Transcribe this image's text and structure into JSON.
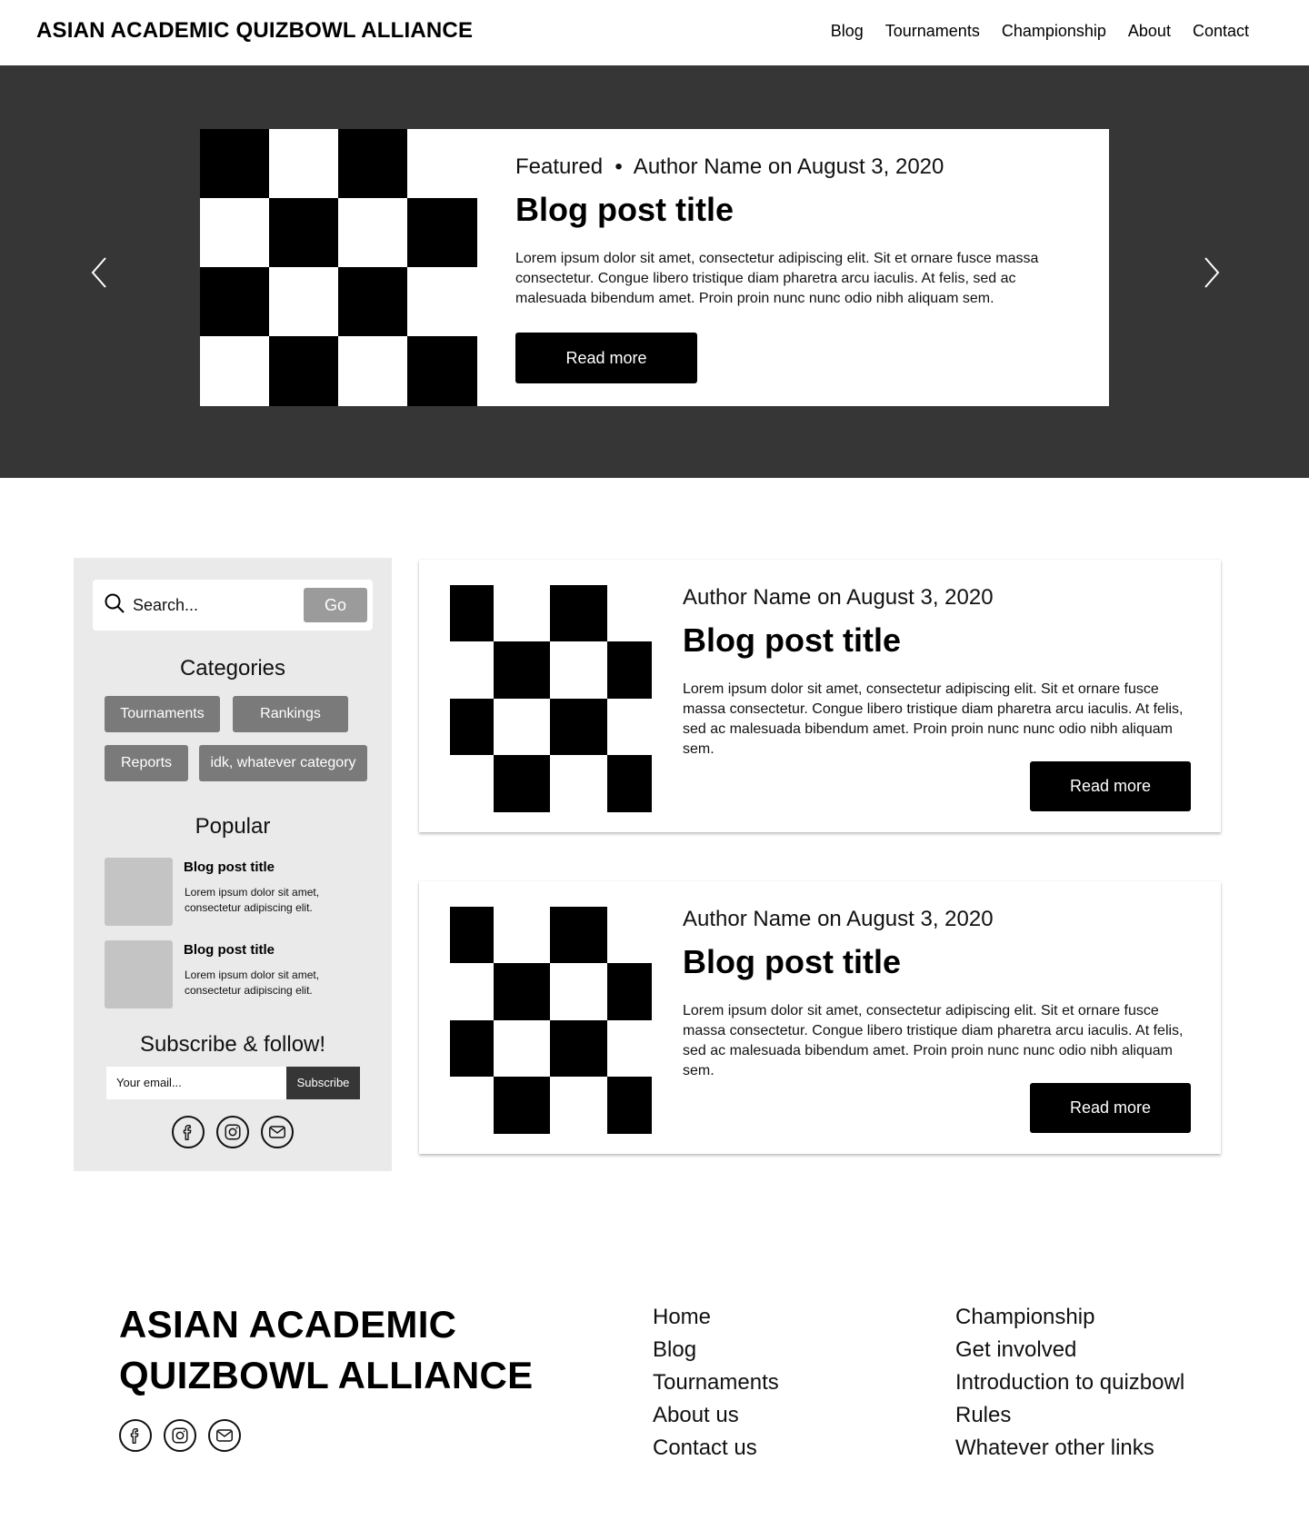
{
  "header": {
    "logo": "ASIAN ACADEMIC QUIZBOWL ALLIANCE",
    "nav": [
      "Blog",
      "Tournaments",
      "Championship",
      "About",
      "Contact"
    ]
  },
  "hero": {
    "meta": "Featured  •  Author Name on August 3, 2020",
    "title": "Blog post title",
    "excerpt": "Lorem ipsum dolor sit amet, consectetur adipiscing elit. Sit et ornare fusce massa consectetur. Congue libero tristique diam pharetra arcu iaculis. At felis, sed ac malesuada bibendum amet. Proin proin nunc nunc odio nibh aliquam sem.",
    "button": "Read more",
    "prev_icon": "chevron-left-icon",
    "next_icon": "chevron-right-icon"
  },
  "sidebar": {
    "search_placeholder": "Search...",
    "go": "Go",
    "categories_title": "Categories",
    "categories": [
      "Tournaments",
      "Rankings",
      "Reports",
      "idk, whatever category"
    ],
    "popular_title": "Popular",
    "popular": [
      {
        "title": "Blog post title",
        "text": "Lorem ipsum dolor sit amet, consectetur adipiscing elit."
      },
      {
        "title": "Blog post title",
        "text": "Lorem ipsum dolor sit amet, consectetur adipiscing elit."
      }
    ],
    "subscribe_title": "Subscribe & follow!",
    "email_placeholder": "Your email...",
    "subscribe_button": "Subscribe",
    "social_icons": [
      "facebook-icon",
      "instagram-icon",
      "mail-icon"
    ]
  },
  "posts": [
    {
      "meta": "Author Name on August 3, 2020",
      "title": "Blog post title",
      "excerpt": "Lorem ipsum dolor sit amet, consectetur adipiscing elit. Sit et ornare fusce massa consectetur. Congue libero tristique diam pharetra arcu iaculis. At felis, sed ac malesuada bibendum amet. Proin proin nunc nunc odio nibh aliquam sem.",
      "button": "Read more"
    },
    {
      "meta": "Author Name on August 3, 2020",
      "title": "Blog post title",
      "excerpt": "Lorem ipsum dolor sit amet, consectetur adipiscing elit. Sit et ornare fusce massa consectetur. Congue libero tristique diam pharetra arcu iaculis. At felis, sed ac malesuada bibendum amet. Proin proin nunc nunc odio nibh aliquam sem.",
      "button": "Read more"
    }
  ],
  "footer": {
    "logo_line1": "ASIAN ACADEMIC",
    "logo_line2": "QUIZBOWL ALLIANCE",
    "col1": [
      "Home",
      "Blog",
      "Tournaments",
      "About us",
      "Contact us"
    ],
    "col2": [
      "Championship",
      "Get involved",
      "Introduction to quizbowl",
      "Rules",
      "Whatever other links"
    ]
  },
  "colors": {
    "hero_bg": "#363636",
    "sidebar_bg": "#eaeaea",
    "chip_bg": "#7a7a7a",
    "go_bg": "#9b9b9b"
  }
}
